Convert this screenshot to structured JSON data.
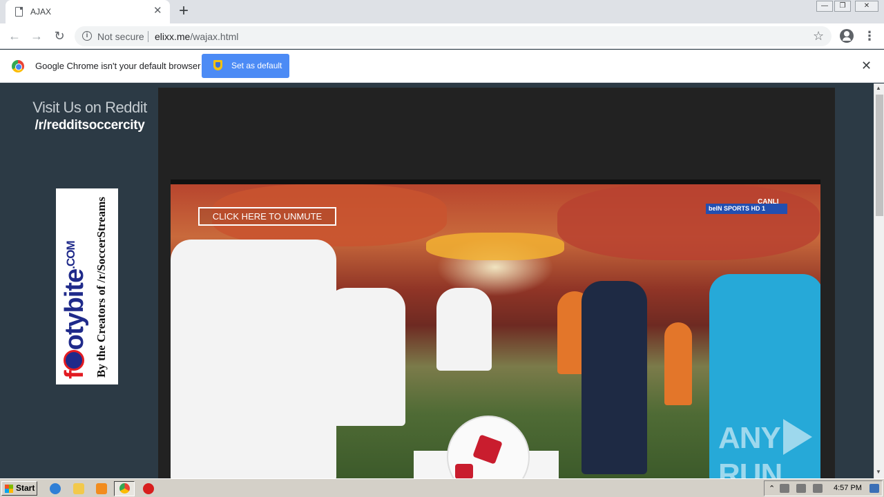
{
  "browser": {
    "tab_title": "AJAX",
    "tab_close": "✕",
    "new_tab": "+",
    "security_label": "Not secure",
    "url_host": "elixx.me",
    "url_path": "/wajax.html",
    "window_min": "—",
    "window_max": "❐",
    "window_close": "✕"
  },
  "infobar": {
    "message": "Google Chrome isn't your default browser",
    "button_label": "Set as default",
    "close": "✕"
  },
  "page": {
    "reddit_line1": "Visit Us on Reddit",
    "reddit_line2": "/r/redditsoccercity",
    "banner_brand_f": "f",
    "banner_brand_rest": "otybite",
    "banner_brand_com": ".COM",
    "banner_tagline": "By the Creators of /r/SoccerStreams"
  },
  "player": {
    "unmute_label": "CLICK HERE TO UNMUTE",
    "channel_label": "beIN SPORTS HD 1",
    "live_label": "CANLI",
    "watermark_left": "ANY",
    "watermark_right": "RUN"
  },
  "taskbar": {
    "start_label": "Start",
    "clock": "4:57 PM"
  },
  "icons": {
    "accent": "#4c8bf5",
    "page_bg": "#2c3a45"
  }
}
